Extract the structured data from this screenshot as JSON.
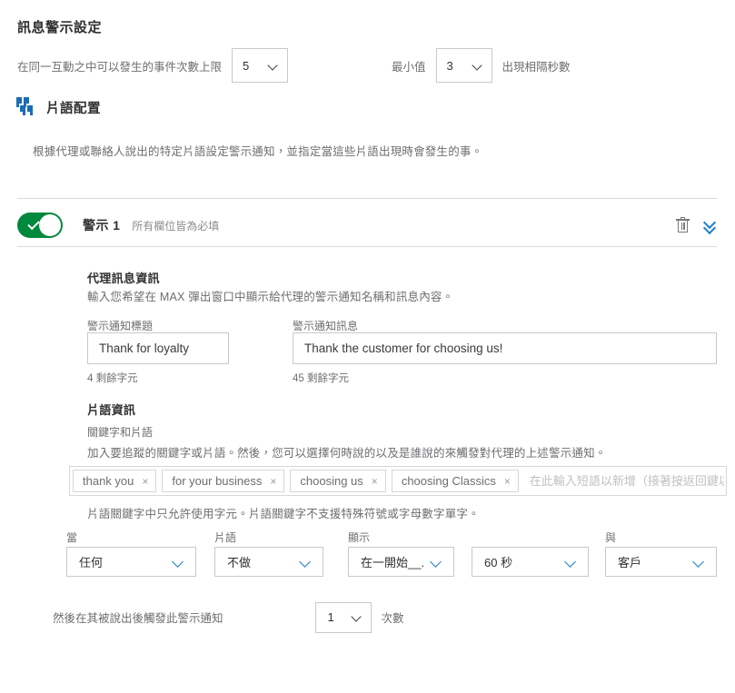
{
  "colors": {
    "accent_blue": "#1b7fc4",
    "quote_blue": "#1b6cb0",
    "toggle_green": "#00883d",
    "text_dark": "#2f3032",
    "text_muted": "#6d6e71",
    "border": "#c8c9ca"
  },
  "message_alert_settings": {
    "title": "訊息警示設定",
    "max_occurrences_label": "在同一互動之中可以發生的事件次數上限",
    "max_occurrences_value": "5",
    "minimum_label": "最小值",
    "minimum_value": "3",
    "minimum_unit": "出現相隔秒數"
  },
  "phrase_config": {
    "icon": "quote-icon",
    "title": "片語配置",
    "description": "根據代理或聯絡人說出的特定片語設定警示通知，並指定當這些片語出現時會發生的事。"
  },
  "alert": {
    "toggle_on": true,
    "name": "警示 1",
    "required_note": "所有欄位皆為必填",
    "delete_icon": "trash-icon",
    "collapse_icon": "chevron-double-down-icon",
    "agent_message": {
      "heading": "代理訊息資訊",
      "description": "輸入您希望在 MAX 彈出窗口中顯示給代理的警示通知名稱和訊息內容。",
      "title_field": {
        "label": "警示通知標題",
        "value": "Thank for loyalty",
        "placeholder": "",
        "counter": "4 剩餘字元"
      },
      "message_field": {
        "label": "警示通知訊息",
        "value": "Thank the customer for choosing us!",
        "placeholder": "",
        "counter": "45 剩餘字元"
      }
    },
    "phrase_info": {
      "heading": "片語資訊",
      "keyword_label": "關鍵字和片語",
      "description": "加入要追蹤的關鍵字或片語。然後，您可以選擇何時說的以及是誰說的來觸發對代理的上述警示通知。",
      "tags": [
        {
          "label": "thank you",
          "remove": "×"
        },
        {
          "label": "for your business",
          "remove": "×"
        },
        {
          "label": "choosing us",
          "remove": "×"
        },
        {
          "label": "choosing Classics",
          "remove": "×"
        }
      ],
      "input_placeholder": "在此輸入短語以新增（接著按返回鍵以加入多",
      "rule_note": "片語關鍵字中只允許使用字元。片語關鍵字不支援特殊符號或字母數字單字。"
    },
    "conditions": [
      {
        "label": "當",
        "value": "任何"
      },
      {
        "label": "片語",
        "value": "不做"
      },
      {
        "label": "顯示",
        "value": "在一開始__..."
      },
      {
        "label": "",
        "value": "60 秒"
      },
      {
        "label": "與",
        "value": "客戶"
      }
    ],
    "trigger": {
      "text": "然後在其被說出後觸發此警示通知",
      "count": "1",
      "unit": "次數"
    }
  }
}
